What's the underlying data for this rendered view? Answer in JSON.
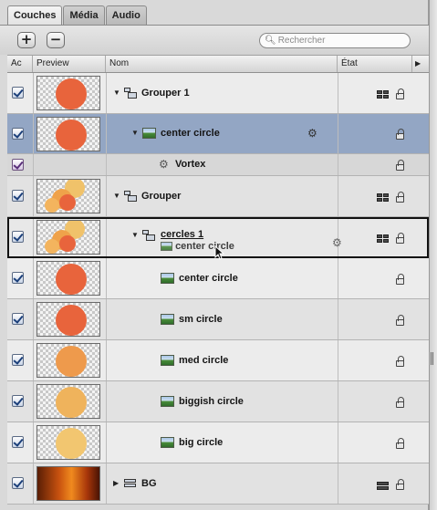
{
  "tabs": [
    {
      "label": "Couches",
      "active": true
    },
    {
      "label": "Média",
      "active": false
    },
    {
      "label": "Audio",
      "active": false
    }
  ],
  "toolbar": {
    "add_label": "+",
    "remove_label": "−",
    "search_placeholder": "Rechercher"
  },
  "columns": {
    "active": "Ac",
    "preview": "Preview",
    "name": "Nom",
    "state": "État",
    "more": "▶"
  },
  "colors": {
    "selected_row": "#93a6c4",
    "circle_orange": "#e8643c",
    "circle_light": "#efb35c"
  },
  "layers": [
    {
      "name": "Grouper 1",
      "type": "group",
      "expanded": true,
      "checked": true,
      "preview": "red-circle"
    },
    {
      "name": "center circle",
      "type": "image",
      "expanded": true,
      "checked": true,
      "preview": "red-circle",
      "selected": true,
      "has_filter": true
    },
    {
      "name": "Vortex",
      "type": "filter",
      "checked": true,
      "preview": "none"
    },
    {
      "name": "Grouper",
      "type": "group",
      "expanded": true,
      "checked": true,
      "preview": "circle-cluster"
    },
    {
      "name": "cercles 1",
      "type": "group",
      "expanded": true,
      "checked": true,
      "preview": "circle-cluster",
      "drop_target": true,
      "has_filter": true
    },
    {
      "name": "center circle",
      "type": "image",
      "checked": true,
      "preview": "red-circle"
    },
    {
      "name": "sm circle",
      "type": "image",
      "checked": true,
      "preview": "red-circle"
    },
    {
      "name": "med circle",
      "type": "image",
      "checked": true,
      "preview": "orange-circle"
    },
    {
      "name": "biggish circle",
      "type": "image",
      "checked": true,
      "preview": "amber-circle"
    },
    {
      "name": "big circle",
      "type": "image",
      "checked": true,
      "preview": "yellow-circle"
    },
    {
      "name": "BG",
      "type": "group",
      "expanded": false,
      "checked": true,
      "preview": "fire"
    }
  ],
  "drag_ghost_label": "center circle"
}
